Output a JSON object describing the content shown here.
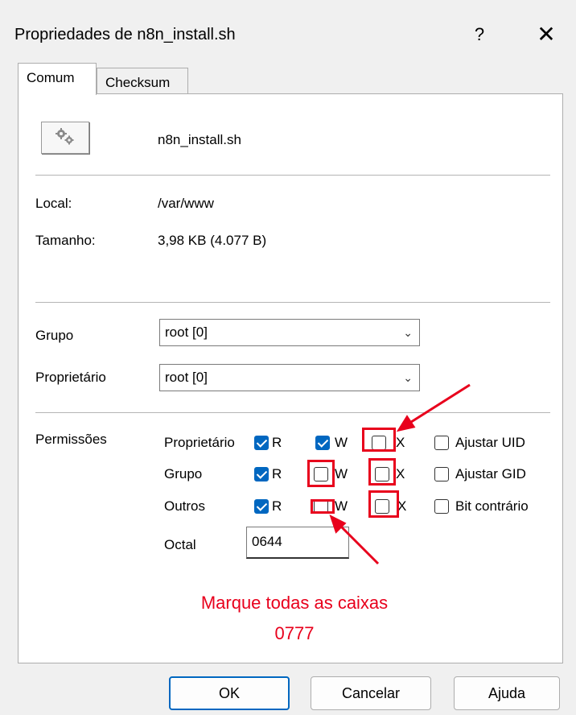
{
  "window": {
    "title": "Propriedades de n8n_install.sh",
    "help_glyph": "?",
    "close_glyph": "✕"
  },
  "tabs": [
    {
      "label": "Comum",
      "active": true
    },
    {
      "label": "Checksum",
      "active": false
    }
  ],
  "file": {
    "icon": "gears-icon",
    "name": "n8n_install.sh"
  },
  "info": {
    "local_label": "Local:",
    "local_value": "/var/www",
    "size_label": "Tamanho:",
    "size_value": "3,98 KB (4.077 B)"
  },
  "ownership": {
    "group_label": "Grupo",
    "group_value": "root [0]",
    "owner_label": "Proprietário",
    "owner_value": "root [0]"
  },
  "permissions": {
    "section_label": "Permissões",
    "rows": [
      {
        "label": "Proprietário",
        "r": true,
        "w": true,
        "x": false,
        "extra_label": "Ajustar UID",
        "extra": false
      },
      {
        "label": "Grupo",
        "r": true,
        "w": false,
        "x": false,
        "extra_label": "Ajustar GID",
        "extra": false
      },
      {
        "label": "Outros",
        "r": true,
        "w": false,
        "x": false,
        "extra_label": "Bit contrário",
        "extra": false
      }
    ],
    "r_label": "R",
    "w_label": "W",
    "x_label": "X",
    "octal_label": "Octal",
    "octal_value": "0644"
  },
  "annotation": {
    "line1": "Marque todas as caixas",
    "line2": "0777",
    "color": "#e8001c"
  },
  "buttons": {
    "ok": "OK",
    "cancel": "Cancelar",
    "help": "Ajuda"
  },
  "colors": {
    "accent": "#0067c0",
    "highlight": "#e8001c"
  }
}
